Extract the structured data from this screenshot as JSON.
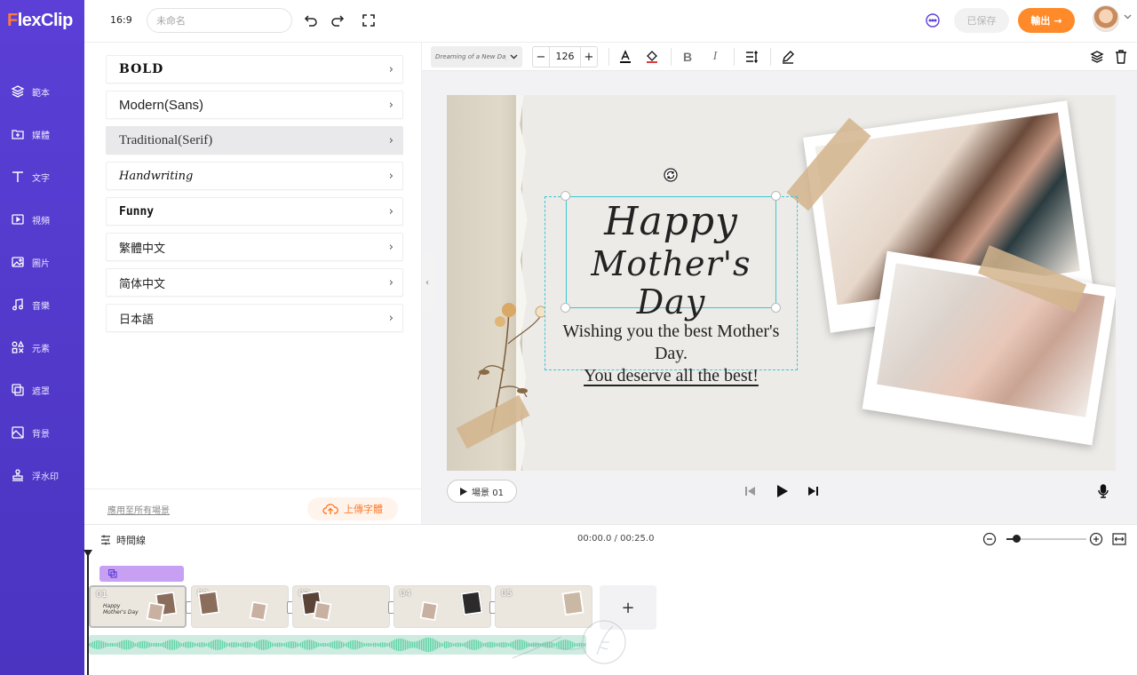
{
  "app": {
    "logo_first": "F",
    "logo_rest": "lexClip"
  },
  "sidebar": {
    "items": [
      {
        "label": "範本",
        "icon": "layers-icon"
      },
      {
        "label": "媒體",
        "icon": "media-add-icon"
      },
      {
        "label": "文字",
        "icon": "text-icon"
      },
      {
        "label": "視頻",
        "icon": "video-icon"
      },
      {
        "label": "圖片",
        "icon": "image-icon"
      },
      {
        "label": "音樂",
        "icon": "music-icon"
      },
      {
        "label": "元素",
        "icon": "elements-icon"
      },
      {
        "label": "遮罩",
        "icon": "overlay-icon"
      },
      {
        "label": "背景",
        "icon": "background-icon"
      },
      {
        "label": "浮水印",
        "icon": "watermark-stamp-icon"
      }
    ]
  },
  "topbar": {
    "ratio": "16:9",
    "name_placeholder": "未命名",
    "saved_label": "已保存",
    "export_label": "輸出",
    "icons": [
      "undo-icon",
      "redo-icon",
      "fullscreen-icon",
      "chat-icon"
    ]
  },
  "font_panel": {
    "categories": [
      {
        "label": "BOLD",
        "active": false
      },
      {
        "label": "Modern(Sans)",
        "active": false
      },
      {
        "label": "Traditional(Serif)",
        "active": true
      },
      {
        "label": "Handwriting",
        "active": false
      },
      {
        "label": "Funny",
        "active": false
      },
      {
        "label": "繁體中文",
        "active": false
      },
      {
        "label": "简体中文",
        "active": false
      },
      {
        "label": "日本語",
        "active": false
      }
    ],
    "apply_all": "應用至所有場景",
    "upload_font": "上傳字體"
  },
  "toolbar": {
    "font_name": "Dreaming of a New Day",
    "font_size": "126",
    "bold": "B",
    "italic": "I"
  },
  "canvas": {
    "title_line1": "Happy",
    "title_line2": "Mother's Day",
    "subtitle_line1": "Wishing you the best Mother's Day.",
    "subtitle_line2": "You deserve all the best!"
  },
  "playbar": {
    "scene_label": "場景 01"
  },
  "timeline": {
    "label": "時間線",
    "time": "00:00.0 / 00:25.0",
    "zoom_level": 0.12,
    "clips": [
      {
        "num": "01",
        "caption": "Happy Mother's Day"
      },
      {
        "num": "02",
        "caption": ""
      },
      {
        "num": "03",
        "caption": ""
      },
      {
        "num": "04",
        "caption": ""
      },
      {
        "num": "05",
        "caption": ""
      }
    ],
    "add_label": "+"
  },
  "colors": {
    "sidebar": "#5b3fd6",
    "accent_orange": "#ff8a2a",
    "selection": "#3dc6d6",
    "audio_wave": "#5fd3a6"
  }
}
